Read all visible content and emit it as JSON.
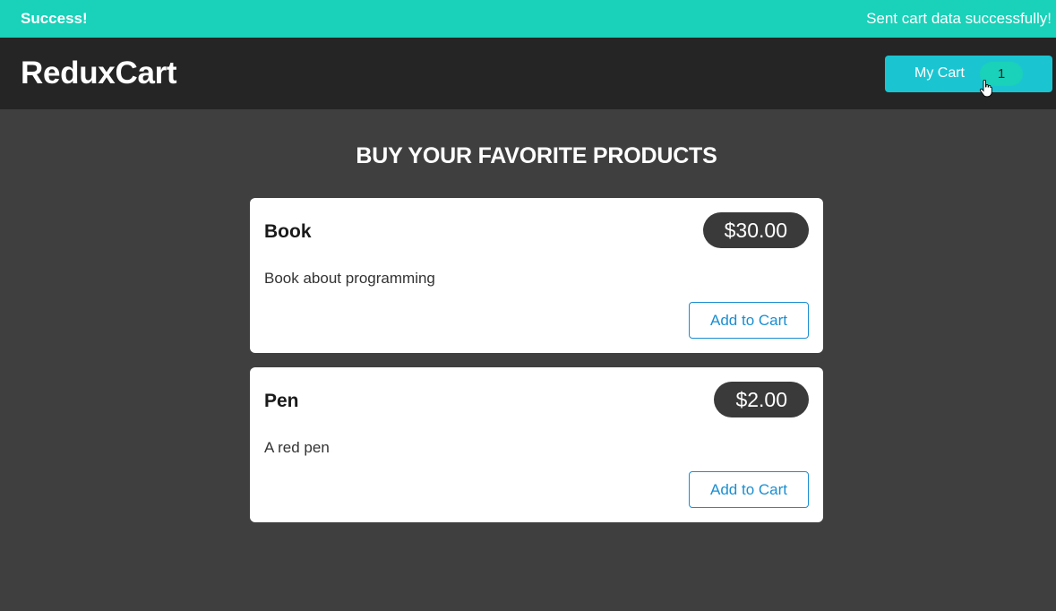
{
  "notification": {
    "title": "Success!",
    "message": "Sent cart data successfully!",
    "color": "#1ad1b9"
  },
  "header": {
    "logo": "ReduxCart",
    "cart_label": "My Cart",
    "cart_count": "1",
    "cursor_icon": "pointer-hand-icon"
  },
  "main": {
    "heading": "BUY YOUR FAVORITE PRODUCTS",
    "products": [
      {
        "title": "Book",
        "price": "$30.00",
        "description": "Book about programming",
        "button_label": "Add to Cart"
      },
      {
        "title": "Pen",
        "price": "$2.00",
        "description": "A red pen",
        "button_label": "Add to Cart"
      }
    ]
  },
  "colors": {
    "background": "#3f3f3f",
    "header": "#252525",
    "accent": "#1ac5d1",
    "link": "#1a8ed1"
  }
}
